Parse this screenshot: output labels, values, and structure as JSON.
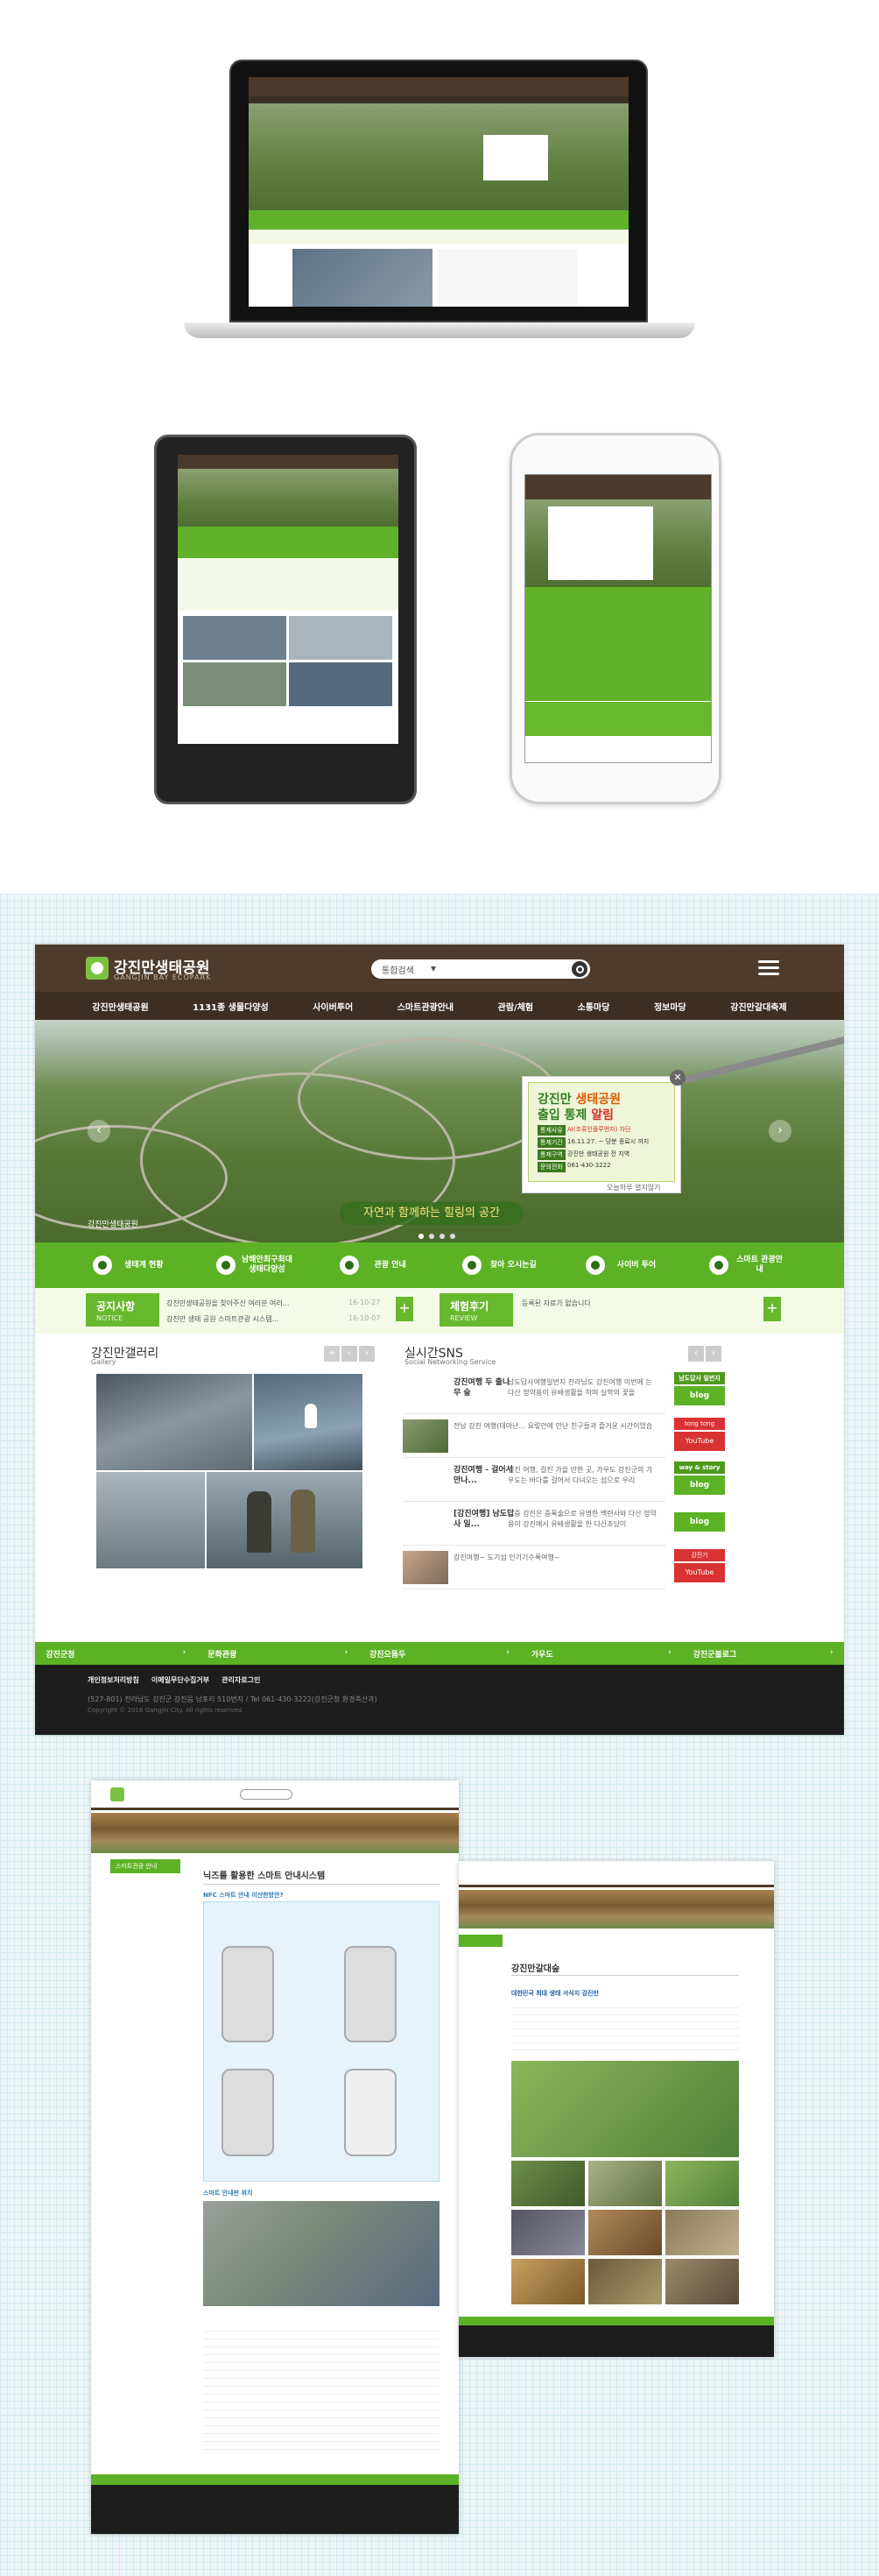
{
  "site": {
    "logo_title": "강진만생태공원",
    "logo_sub": "GANGJIN BAY ECOPARK",
    "search_scope": "통합검색",
    "menu": [
      "강진만생태공원",
      "1131종 생물다양성",
      "사이버투어",
      "스마트관광안내",
      "관람/체험",
      "소통마당",
      "정보마당",
      "강진만갈대축제"
    ],
    "popup": {
      "title_a": "강진만",
      "title_b": "생태공원",
      "title_c": "출입 통제",
      "title_d": "알림",
      "labels": [
        "통제사유",
        "통제기간",
        "통제구역",
        "문의전화"
      ],
      "rows": [
        "AI(조류인플루엔자) 차단",
        "16.11.27. ~ 당분 종료시 까지",
        "강진만 생태공원 전 지역",
        "061-430-3222"
      ],
      "close_today": "오늘하루 열지않기"
    },
    "hero_caption": "강진만생태공원",
    "slogan": "자연과 함께하는 힐링의 공간",
    "quick": [
      "생태계 현황",
      "남해안최구최대 생태다양성",
      "관광 안내",
      "찾아 오시는길",
      "사이버 투어",
      "스마트 관광안내"
    ],
    "notice": {
      "title": "공지사항",
      "sub": "NOTICE",
      "items": [
        {
          "text": "강진만생태공원을 찾아주신 여러분 여러...",
          "date": "16-10-27"
        },
        {
          "text": "강진만 생태 공원 스마트관광 시스템...",
          "date": "16-10-07"
        }
      ]
    },
    "review": {
      "title": "체험후기",
      "sub": "REVIEW",
      "empty": "등록된 자료가 없습니다"
    },
    "gallery": {
      "title": "강진만갤러리",
      "sub": "Gallery"
    },
    "sns": {
      "title": "실시간SNS",
      "sub": "Social Networking Service",
      "rows": [
        {
          "title": "강진여행 두 출나무 숲",
          "text": "남도답사여행일번지 전라남도 강진여행 이번에 는 다산 정약용이 유배생활을 하며 실학의 꽃을"
        },
        {
          "title": "",
          "text": "전남 강진 여행(데마난... 요렇안에 만난 친구들과 즐거운 시간이었습"
        },
        {
          "title": "강진여행 - 걸어서 만나...",
          "text": "걸진 여행, 걸진 가을 만한 곳, 가우도 강진군의 가우도는 바다를 걸어서 다녀오는 섬으로 우리"
        },
        {
          "title": "[강진여행] 남도답사 일...",
          "text": "그중 강진은 중폭술으로 유명한 백련사와 다산 정약용이 강진에서 유배생활을 한 다산초당이"
        },
        {
          "title": "",
          "text": "강진여행~ 도기섬 인기기수록여행~"
        }
      ],
      "badges": [
        {
          "top": "남도답사 일번지",
          "bottom": "blog"
        },
        {
          "top": "tong tong",
          "bottom": "YouTube"
        },
        {
          "top": "way & story",
          "bottom": "blog"
        },
        {
          "top": "",
          "bottom": "blog"
        },
        {
          "top": "강진기",
          "bottom": "YouTube"
        }
      ]
    },
    "family": [
      "강진군청",
      "문화관광",
      "강진으뜸두",
      "가우도",
      "강진군블로그"
    ],
    "footer": {
      "links": [
        "개인정보처리방침",
        "이메일무단수집거부",
        "관리자로그인"
      ],
      "address": "(527-801) 전라남도 강진군 강진읍 남포리 510번지 / Tel 061-430-3222(강진군청 환경축산과)",
      "copy": "Copyright © 2016 Gangjin City. All rights reserved."
    }
  },
  "subpages": {
    "page1": {
      "side_title": "스마트관광 안내",
      "title": "닉즈를 활용한 스마트 안내시스템",
      "section1": "NFC 스마트 안내 이산한방안?",
      "section2": "스마트 안내판 위치"
    },
    "page2": {
      "title": "강진만갈대숲",
      "headline": "대한민국 최대 생태 서식지 강진만"
    }
  }
}
